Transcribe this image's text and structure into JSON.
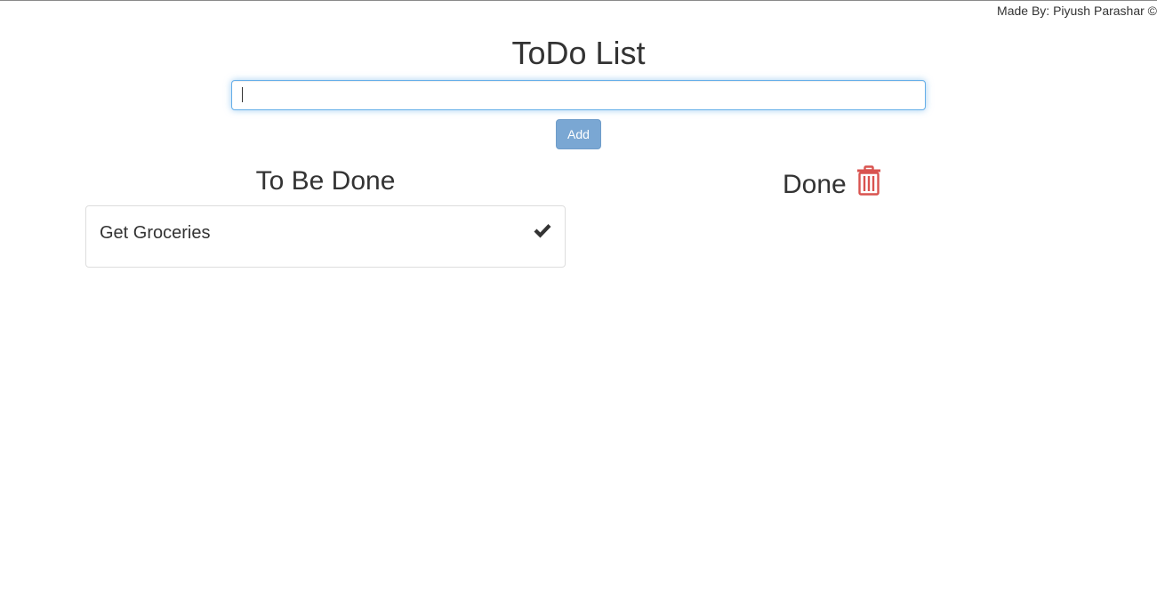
{
  "credit": "Made By: Piyush Parashar ©",
  "app": {
    "title": "ToDo List"
  },
  "input": {
    "value": "",
    "placeholder": ""
  },
  "actions": {
    "add_label": "Add"
  },
  "columns": {
    "todo": {
      "heading": "To Be Done",
      "items": [
        {
          "text": "Get Groceries",
          "icon": "checkmark-icon"
        }
      ]
    },
    "done": {
      "heading": "Done",
      "items": [],
      "icon": "trash-icon"
    }
  },
  "colors": {
    "accent_button": "#7aa7d3",
    "input_focus": "#66afe9",
    "trash": "#d9534f",
    "text": "#333333"
  }
}
